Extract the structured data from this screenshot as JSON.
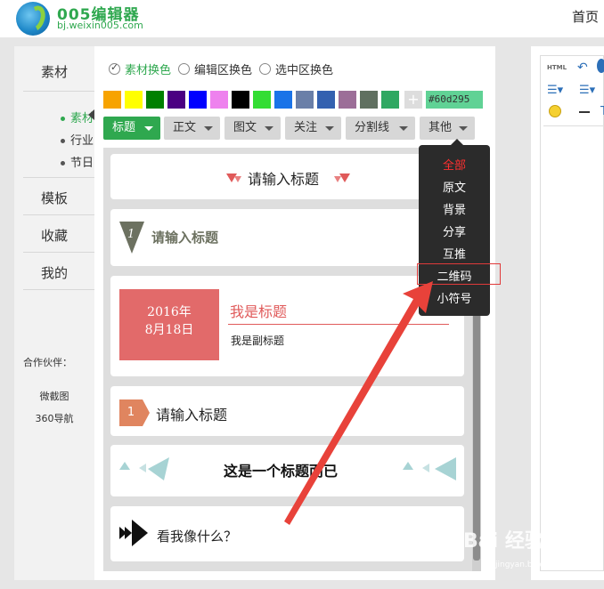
{
  "header": {
    "logo_title": "005编辑器",
    "logo_url": "bj.weixin005.com",
    "nav_home": "首页"
  },
  "sidebar": {
    "sections": [
      "素材",
      "模板",
      "收藏",
      "我的"
    ],
    "sub_items": [
      {
        "label": "素材",
        "active": true
      },
      {
        "label": "行业",
        "active": false
      },
      {
        "label": "节日",
        "active": false
      }
    ],
    "partners_title": "合作伙伴：",
    "partners": [
      "微截图",
      "360导航"
    ]
  },
  "color_mode": {
    "options": [
      {
        "label": "素材换色",
        "checked": true
      },
      {
        "label": "编辑区换色",
        "checked": false
      },
      {
        "label": "选中区换色",
        "checked": false
      }
    ]
  },
  "palette": {
    "colors": [
      "#f7a300",
      "#ffff00",
      "#008000",
      "#4b0082",
      "#0000ff",
      "#ee82ee",
      "#000000",
      "#33dd33",
      "#1a73e8",
      "#6a7fa8",
      "#3461b0",
      "#9c6e98",
      "#607060",
      "#2fa862"
    ],
    "current": "#60d295"
  },
  "tabs": [
    "标题",
    "正文",
    "图文",
    "关注",
    "分割线",
    "其他"
  ],
  "active_tab": "标题",
  "cards": {
    "c1_title": "请输入标题",
    "c2_title": "请输入标题",
    "c2_number": "1",
    "c3_date_line1": "2016年",
    "c3_date_line2": "8月18日",
    "c3_title": "我是标题",
    "c3_subtitle": "我是副标题",
    "c4_number": "1",
    "c4_title": "请输入标题",
    "c5_title": "这是一个标题而已",
    "c6_title": "看我像什么？"
  },
  "dropdown": {
    "items": [
      "全部",
      "原文",
      "背景",
      "分享",
      "互推",
      "二维码",
      "小符号"
    ],
    "active": "全部",
    "highlighted": "二维码"
  },
  "editor_toolbar": {
    "html_label": "HTML"
  },
  "watermark": {
    "text": "Bai 经验",
    "sub": "jingyan.baidu.com"
  }
}
